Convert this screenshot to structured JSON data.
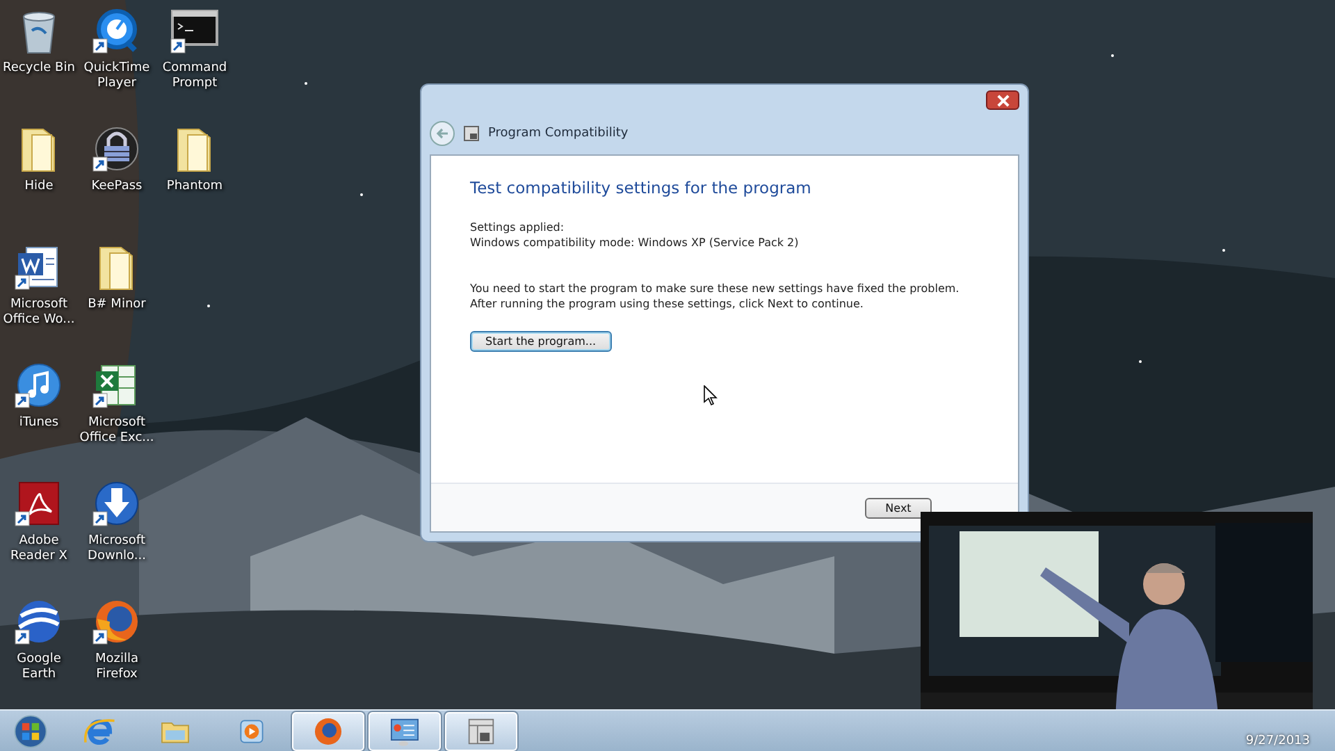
{
  "desktop_icons": [
    {
      "label": "Recycle Bin",
      "kind": "recycle-bin",
      "shortcut": false
    },
    {
      "label": "Hide",
      "kind": "folder",
      "shortcut": false
    },
    {
      "label": "Microsoft Office Wo...",
      "kind": "word",
      "shortcut": true
    },
    {
      "label": "iTunes",
      "kind": "music",
      "shortcut": true
    },
    {
      "label": "Adobe Reader X",
      "kind": "pdf",
      "shortcut": true
    },
    {
      "label": "Google Earth",
      "kind": "globe",
      "shortcut": true
    },
    {
      "label": "QuickTime Player",
      "kind": "quicktime",
      "shortcut": true
    },
    {
      "label": "KeePass",
      "kind": "lock",
      "shortcut": true
    },
    {
      "label": "B# Minor",
      "kind": "folder",
      "shortcut": false
    },
    {
      "label": "Microsoft Office Exc...",
      "kind": "excel",
      "shortcut": true
    },
    {
      "label": "Microsoft Downlo...",
      "kind": "download",
      "shortcut": true
    },
    {
      "label": "Mozilla Firefox",
      "kind": "firefox",
      "shortcut": true
    },
    {
      "label": "Command Prompt",
      "kind": "terminal",
      "shortcut": true
    },
    {
      "label": "Phantom",
      "kind": "folder",
      "shortcut": false
    }
  ],
  "dialog": {
    "title": "Program Compatibility",
    "heading": "Test compatibility settings for the program",
    "settings_label": "Settings applied:",
    "settings_value": "Windows compatibility mode: Windows XP (Service Pack 2)",
    "instructions": "You need to start the program to make sure these new settings have fixed the problem. After running the program using these settings, click Next to continue.",
    "start_button": "Start the program...",
    "next_button": "Next"
  },
  "taskbar": {
    "items": [
      {
        "kind": "start",
        "running": false
      },
      {
        "kind": "browser",
        "running": false
      },
      {
        "kind": "folder",
        "running": false
      },
      {
        "kind": "media",
        "running": false
      },
      {
        "kind": "firefox",
        "running": true
      },
      {
        "kind": "panel",
        "running": true
      },
      {
        "kind": "compat",
        "running": true
      }
    ],
    "date": "9/27/2013"
  }
}
